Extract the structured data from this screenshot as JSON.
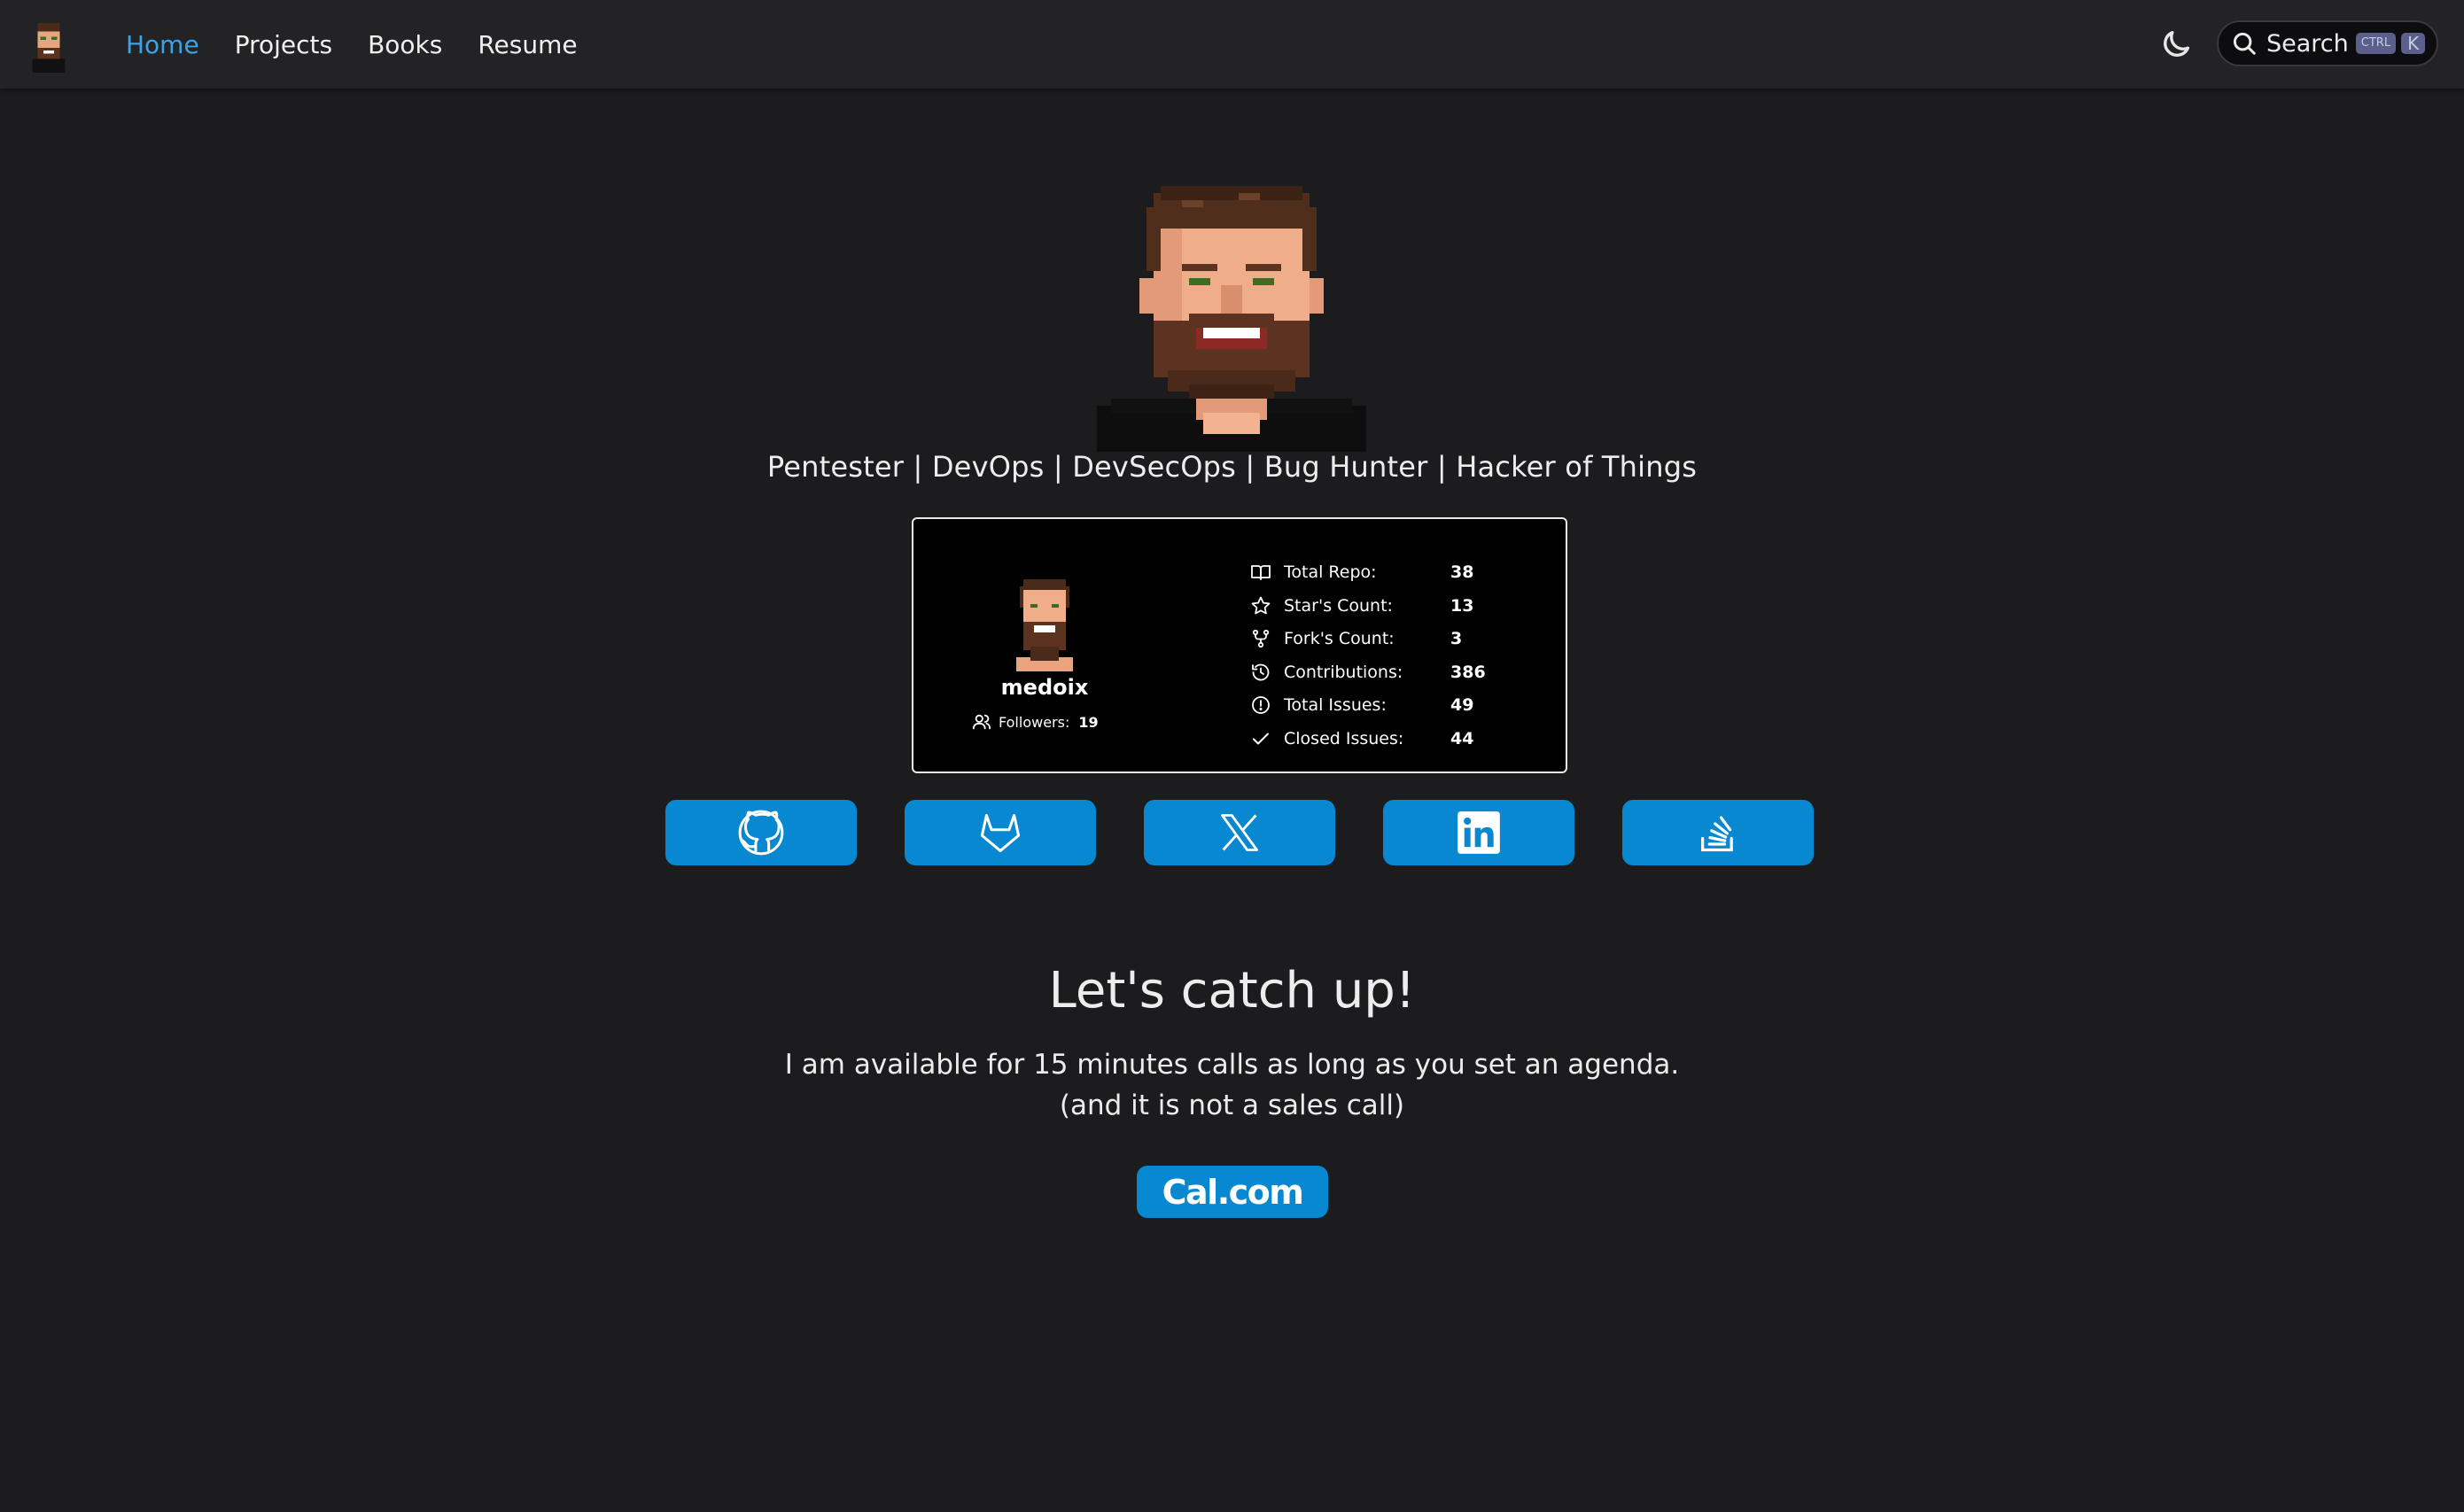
{
  "nav": {
    "links": [
      "Home",
      "Projects",
      "Books",
      "Resume"
    ],
    "active": "Home",
    "search_label": "Search",
    "shortcut_ctrl": "CTRL",
    "shortcut_key": "K",
    "logo_icon": "avatar-logo",
    "theme_icon": "moon-icon"
  },
  "hero": {
    "tagline": "Pentester | DevOps | DevSecOps | Bug Hunter | Hacker of Things"
  },
  "stats_card": {
    "username": "medoix",
    "followers_label": "Followers:",
    "followers_value": "19",
    "stats": [
      {
        "icon": "book-icon",
        "label": "Total Repo:",
        "value": "38"
      },
      {
        "icon": "star-icon",
        "label": "Star's Count:",
        "value": "13"
      },
      {
        "icon": "fork-icon",
        "label": "Fork's Count:",
        "value": "3"
      },
      {
        "icon": "history-icon",
        "label": "Contributions:",
        "value": "386"
      },
      {
        "icon": "issue-icon",
        "label": "Total Issues:",
        "value": "49"
      },
      {
        "icon": "check-icon",
        "label": "Closed Issues:",
        "value": "44"
      }
    ]
  },
  "social": [
    {
      "name": "github",
      "icon": "github-icon"
    },
    {
      "name": "gitlab",
      "icon": "gitlab-icon"
    },
    {
      "name": "x",
      "icon": "x-icon"
    },
    {
      "name": "linkedin",
      "icon": "linkedin-icon"
    },
    {
      "name": "stackoverflow",
      "icon": "stackoverflow-icon"
    }
  ],
  "catch_up": {
    "title": "Let's catch up!",
    "line1": "I am available for 15 minutes calls as long as you set an agenda.",
    "line2": "(and it is not a sales call)",
    "cal_label": "Cal.com"
  },
  "colors": {
    "background": "#1c1c1e",
    "navbar": "#232325",
    "accent": "#0788d0",
    "active_link": "#3ba3e8"
  }
}
